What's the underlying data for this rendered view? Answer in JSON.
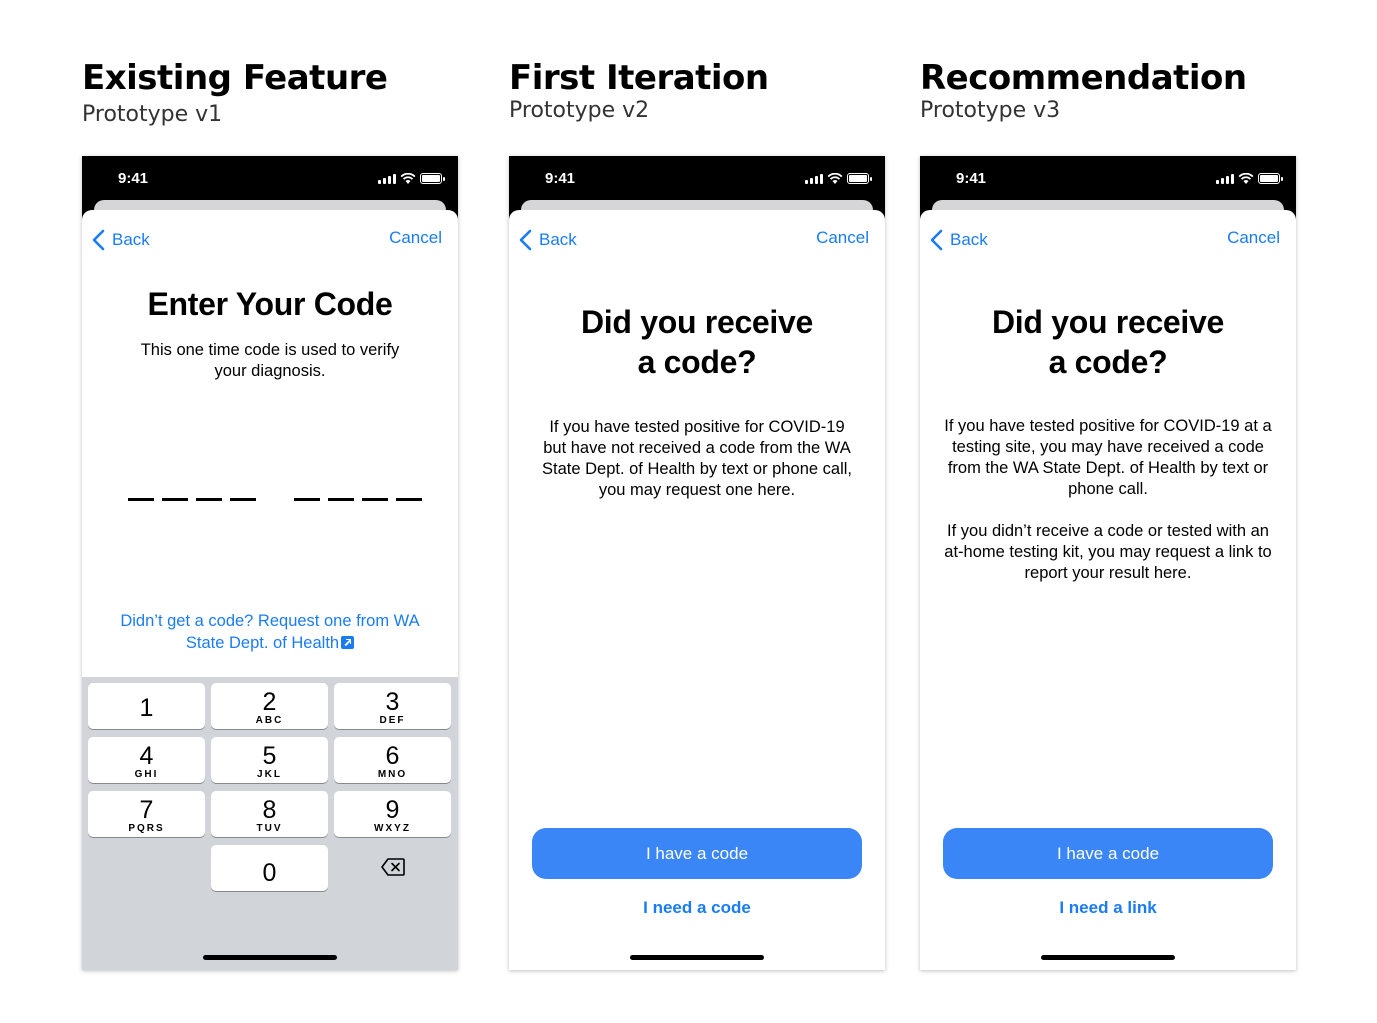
{
  "columns": [
    {
      "title": "Existing Feature",
      "subtitle": "Prototype v1"
    },
    {
      "title": "First Iteration",
      "subtitle": "Prototype v2"
    },
    {
      "title": "Recommendation",
      "subtitle": "Prototype v3"
    }
  ],
  "status_bar": {
    "time": "9:41"
  },
  "nav": {
    "back_label": "Back",
    "cancel_label": "Cancel"
  },
  "v1": {
    "heading": "Enter Your Code",
    "description": "This one time code is used to verify your diagnosis.",
    "code_length": 8,
    "request_link": "Didn’t get a code? Request one from WA State Dept. of Health",
    "keypad": [
      {
        "num": "1",
        "letters": ""
      },
      {
        "num": "2",
        "letters": "ABC"
      },
      {
        "num": "3",
        "letters": "DEF"
      },
      {
        "num": "4",
        "letters": "GHI"
      },
      {
        "num": "5",
        "letters": "JKL"
      },
      {
        "num": "6",
        "letters": "MNO"
      },
      {
        "num": "7",
        "letters": "PQRS"
      },
      {
        "num": "8",
        "letters": "TUV"
      },
      {
        "num": "9",
        "letters": "WXYZ"
      },
      {
        "num": "0",
        "letters": ""
      }
    ]
  },
  "v2": {
    "heading_line1": "Did you receive",
    "heading_line2": "a code?",
    "description": "If you have tested positive for COVID-19 but have not received a code from the WA State Dept. of Health by text or phone call, you may request one here.",
    "primary_button": "I have a code",
    "secondary_button": "I need a code"
  },
  "v3": {
    "heading_line1": "Did you receive",
    "heading_line2": "a code?",
    "description_1": "If you have tested positive for COVID-19 at a testing site, you may have received a code from the WA State Dept. of Health by text or phone call.",
    "description_2": "If you didn’t receive a code or tested with an at-home testing kit, you may request a link to report your result here.",
    "primary_button": "I have a code",
    "secondary_button": "I need a link"
  },
  "colors": {
    "accent": "#1a7cf5",
    "button": "#3a86f6",
    "keypad_bg": "#d1d4d9"
  }
}
